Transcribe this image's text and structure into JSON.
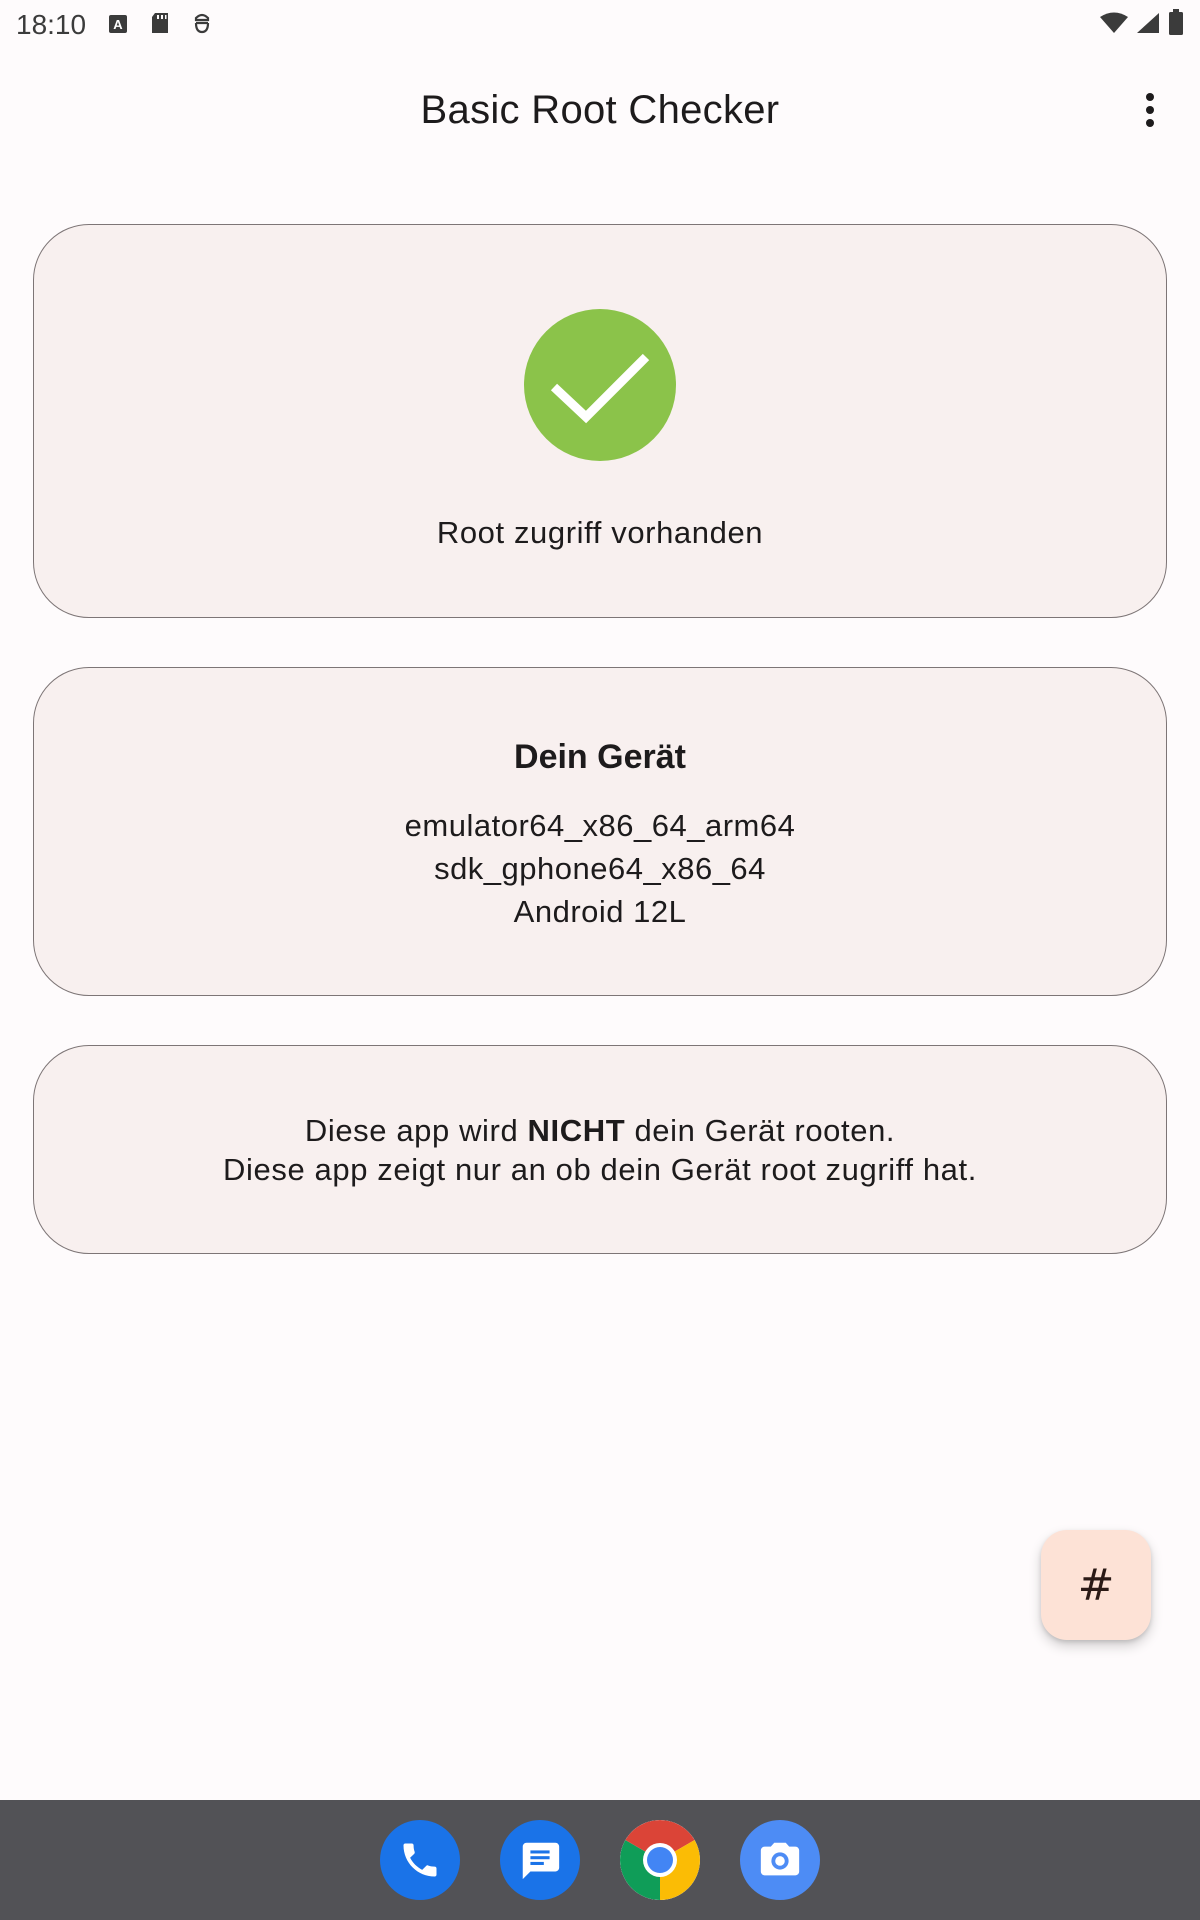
{
  "status_bar": {
    "time": "18:10"
  },
  "app_bar": {
    "title": "Basic Root Checker",
    "overflow_icon": "more-vert-icon"
  },
  "root_status": {
    "icon": "check-circle-icon",
    "icon_color": "#8bc34a",
    "text": "Root zugriff vorhanden"
  },
  "device": {
    "title": "Dein Gerät",
    "lines": [
      "emulator64_x86_64_arm64",
      "sdk_gphone64_x86_64",
      "Android 12L"
    ]
  },
  "info": {
    "line1_before": "Diese app wird ",
    "line1_bold": "NICHT",
    "line1_after": " dein Gerät rooten.",
    "line2": "Diese app zeigt nur an ob dein Gerät root zugriff hat."
  },
  "fab": {
    "label": "#"
  },
  "dock": {
    "apps": [
      "phone-icon",
      "messages-icon",
      "chrome-icon",
      "camera-icon"
    ]
  },
  "colors": {
    "card_bg": "#f8f0ef",
    "fab_bg": "#fde2d6",
    "dock_bg": "#525256"
  }
}
